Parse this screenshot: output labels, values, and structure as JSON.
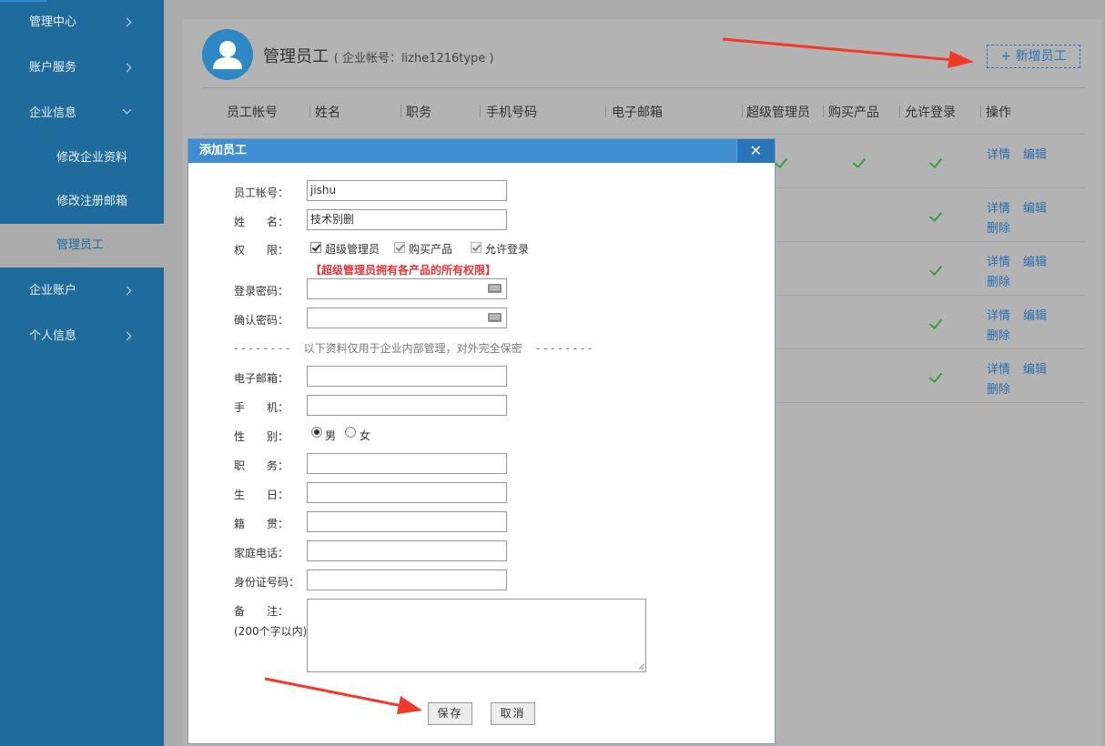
{
  "sidebar": {
    "items": [
      {
        "label": "管理中心",
        "expanded": false
      },
      {
        "label": "账户服务",
        "expanded": false
      },
      {
        "label": "企业信息",
        "expanded": true
      },
      {
        "label": "企业账户",
        "expanded": false
      },
      {
        "label": "个人信息",
        "expanded": false
      }
    ],
    "sub_items": [
      {
        "label": "修改企业资料",
        "active": false
      },
      {
        "label": "修改注册邮箱",
        "active": false
      },
      {
        "label": "管理员工",
        "active": true
      }
    ]
  },
  "header": {
    "title": "管理员工",
    "subtitle": "( 企业帐号：lizhe1216type )",
    "add_button": "+ 新增员工"
  },
  "table": {
    "columns": [
      "员工帐号",
      "姓名",
      "职务",
      "手机号码",
      "电子邮箱",
      "超级管理员",
      "购买产品",
      "允许登录",
      "操作"
    ],
    "rows": [
      {
        "super_admin": true,
        "buy": true,
        "login": true,
        "ops": [
          "详情",
          "编辑"
        ]
      },
      {
        "super_admin": false,
        "buy": false,
        "login": true,
        "ops": [
          "详情",
          "编辑",
          "删除"
        ]
      },
      {
        "super_admin": false,
        "buy": false,
        "login": true,
        "ops": [
          "详情",
          "编辑",
          "删除"
        ]
      },
      {
        "super_admin": false,
        "buy": false,
        "login": true,
        "ops": [
          "详情",
          "编辑",
          "删除"
        ]
      },
      {
        "super_admin": false,
        "buy": false,
        "login": true,
        "ops": [
          "详情",
          "编辑",
          "删除"
        ]
      }
    ]
  },
  "dialog": {
    "title": "添加员工",
    "close": "✕",
    "fields": {
      "account": {
        "label": "员工帐号：",
        "value": "jishu"
      },
      "name": {
        "label": "姓　　名：",
        "value": "技术别删"
      },
      "perm_label": "权　　限：",
      "perms": [
        {
          "label": "超级管理员",
          "checked": true
        },
        {
          "label": "购买产品",
          "checked": true
        },
        {
          "label": "允许登录",
          "checked": true
        }
      ],
      "perm_warning": "【超级管理员拥有各产品的所有权限】",
      "password": {
        "label": "登录密码：",
        "value": ""
      },
      "confirm": {
        "label": "确认密码：",
        "value": ""
      },
      "separator": "- - - - - - - -    以下资料仅用于企业内部管理，对外完全保密    - - - - - - - -",
      "email": {
        "label": "电子邮箱：",
        "value": ""
      },
      "mobile": {
        "label": "手　　机：",
        "value": ""
      },
      "gender_label": "性　　别：",
      "gender_options": [
        "男",
        "女"
      ],
      "gender_selected": "男",
      "position": {
        "label": "职　　务：",
        "value": ""
      },
      "birthday": {
        "label": "生　　日：",
        "value": ""
      },
      "native": {
        "label": "籍　　贯：",
        "value": ""
      },
      "home_phone": {
        "label": "家庭电话：",
        "value": ""
      },
      "id_number": {
        "label": "身份证号码：",
        "value": ""
      },
      "remark_label": "备　　注：",
      "remark_hint": "(200个字以内)"
    },
    "save": "保存",
    "cancel": "取消"
  },
  "colors": {
    "sidebar": "#1f6b9c",
    "accent": "#2a74b8",
    "warning": "#e0383b",
    "check": "#3e9a3e",
    "annotation_arrow": "#f03a2a"
  }
}
